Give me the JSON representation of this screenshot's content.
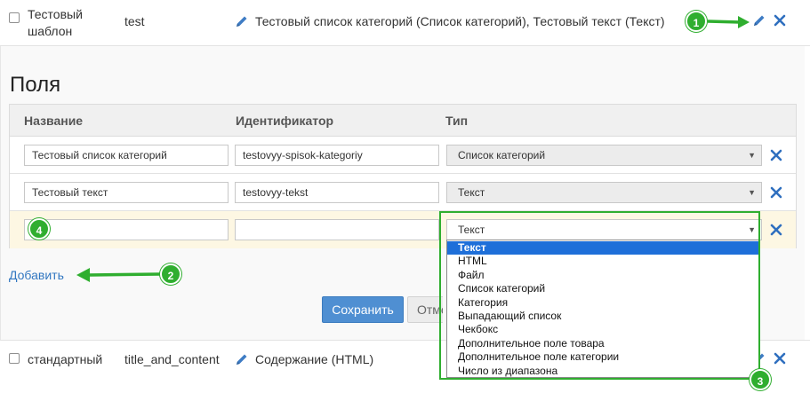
{
  "templates": [
    {
      "name": "Тестовый шаблон",
      "name_line1": "Тестовый",
      "name_line2": "шаблон",
      "id": "test",
      "fields_summary": "Тестовый список категорий (Список категорий), Тестовый текст (Текст)"
    },
    {
      "name": "стандартный",
      "id": "title_and_content",
      "fields_summary": "Содержание (HTML)"
    }
  ],
  "fields_section": {
    "title": "Поля",
    "columns": {
      "name": "Название",
      "identifier": "Идентификатор",
      "type": "Тип"
    },
    "rows": [
      {
        "name": "Тестовый список категорий",
        "identifier": "testovyy-spisok-kategoriy",
        "type": "Список категорий"
      },
      {
        "name": "Тестовый текст",
        "identifier": "testovyy-tekst",
        "type": "Текст"
      },
      {
        "name": "",
        "identifier": "",
        "type": "Текст"
      }
    ],
    "type_options": [
      "Текст",
      "HTML",
      "Файл",
      "Список категорий",
      "Категория",
      "Выпадающий список",
      "Чекбокс",
      "Дополнительное поле товара",
      "Дополнительное поле категории",
      "Число из диапазона"
    ],
    "selected_option": "Текст",
    "add_label": "Добавить",
    "save_label": "Сохранить",
    "cancel_label": "Отмена"
  },
  "annotations": [
    "1",
    "2",
    "3",
    "4"
  ],
  "colors": {
    "accent_green": "#2fae2f",
    "link_blue": "#3277c1",
    "save_blue": "#4f8fd2",
    "remove_blue": "#2f6fbf",
    "selected_option_blue": "#1e6fd9"
  },
  "icons": {
    "edit": "pencil-icon",
    "remove": "close-icon",
    "select": "chevron-down-icon"
  }
}
